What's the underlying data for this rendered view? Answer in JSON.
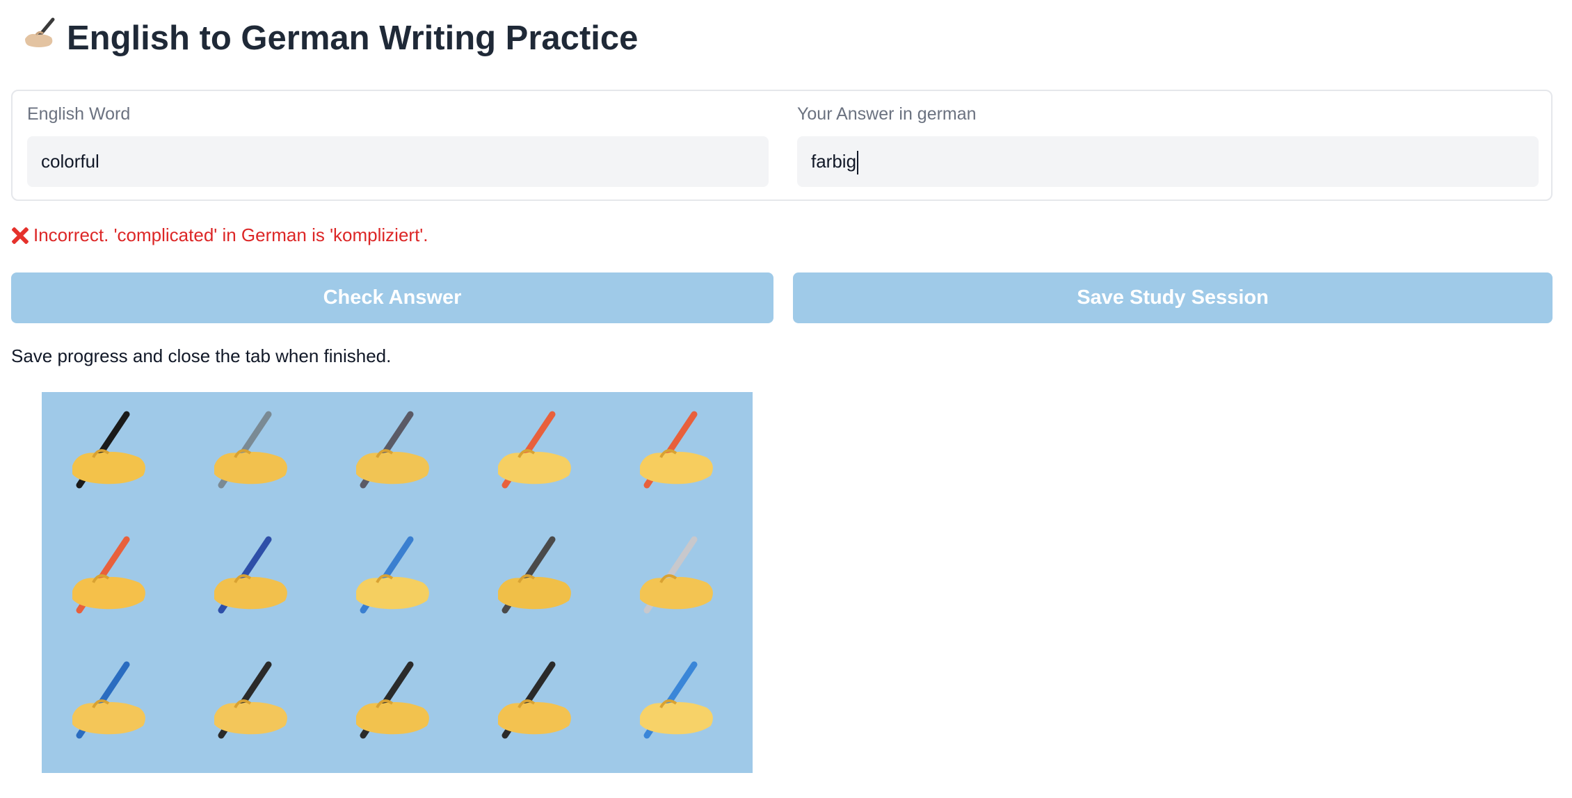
{
  "header": {
    "icon": "writing-hand-icon",
    "title": "English to German Writing Practice"
  },
  "form": {
    "english_label": "English Word",
    "english_value": "colorful",
    "answer_label": "Your Answer in german",
    "answer_value": "farbig"
  },
  "feedback": {
    "icon": "cross-mark-icon",
    "text": "Incorrect. 'complicated' in German is 'kompliziert'.",
    "color": "#dc2626"
  },
  "buttons": {
    "check_label": "Check Answer",
    "save_label": "Save Study Session",
    "color": "#9fcae8"
  },
  "hint": "Save progress and close the tab when finished.",
  "image": {
    "background": "#9fc9e8",
    "icons": [
      "writing-hand-icon",
      "writing-hand-icon",
      "writing-hand-icon",
      "writing-hand-icon",
      "writing-hand-icon",
      "writing-hand-icon",
      "writing-hand-icon",
      "writing-hand-icon",
      "writing-hand-icon",
      "writing-hand-icon",
      "writing-hand-icon",
      "writing-hand-icon",
      "writing-hand-icon",
      "writing-hand-icon",
      "writing-hand-icon"
    ]
  }
}
